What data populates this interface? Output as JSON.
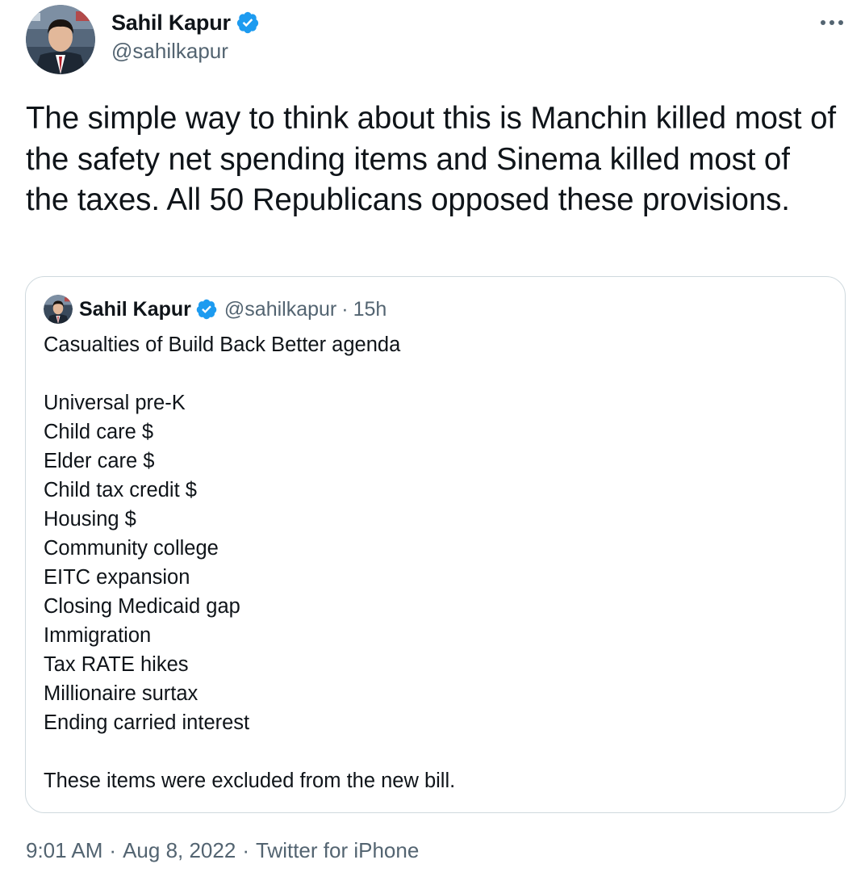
{
  "author": {
    "name": "Sahil Kapur",
    "handle": "@sahilkapur",
    "verified_color": "#1d9bf0"
  },
  "tweet": {
    "text": "The simple way to think about this is Manchin killed most of the safety net spending items and Sinema killed most of the taxes. All 50 Republicans opposed these provisions."
  },
  "quoted_tweet": {
    "name": "Sahil Kapur",
    "handle": "@sahilkapur",
    "separator": "·",
    "time": "15h",
    "intro": "Casualties of Build Back Better agenda",
    "items": [
      "Universal pre-K",
      "Child care $",
      "Elder care $",
      "Child tax credit $",
      "Housing $",
      "Community college",
      "EITC expansion",
      "Closing Medicaid gap",
      "Immigration",
      "Tax RATE hikes",
      "Millionaire surtax",
      "Ending carried interest"
    ],
    "outro": "These items were excluded from the new bill."
  },
  "meta": {
    "time": "9:01 AM",
    "separator": "·",
    "date": "Aug 8, 2022",
    "source": "Twitter for iPhone"
  },
  "icons": {
    "more": "more-horizontal-icon",
    "verified": "verified-badge-icon"
  }
}
